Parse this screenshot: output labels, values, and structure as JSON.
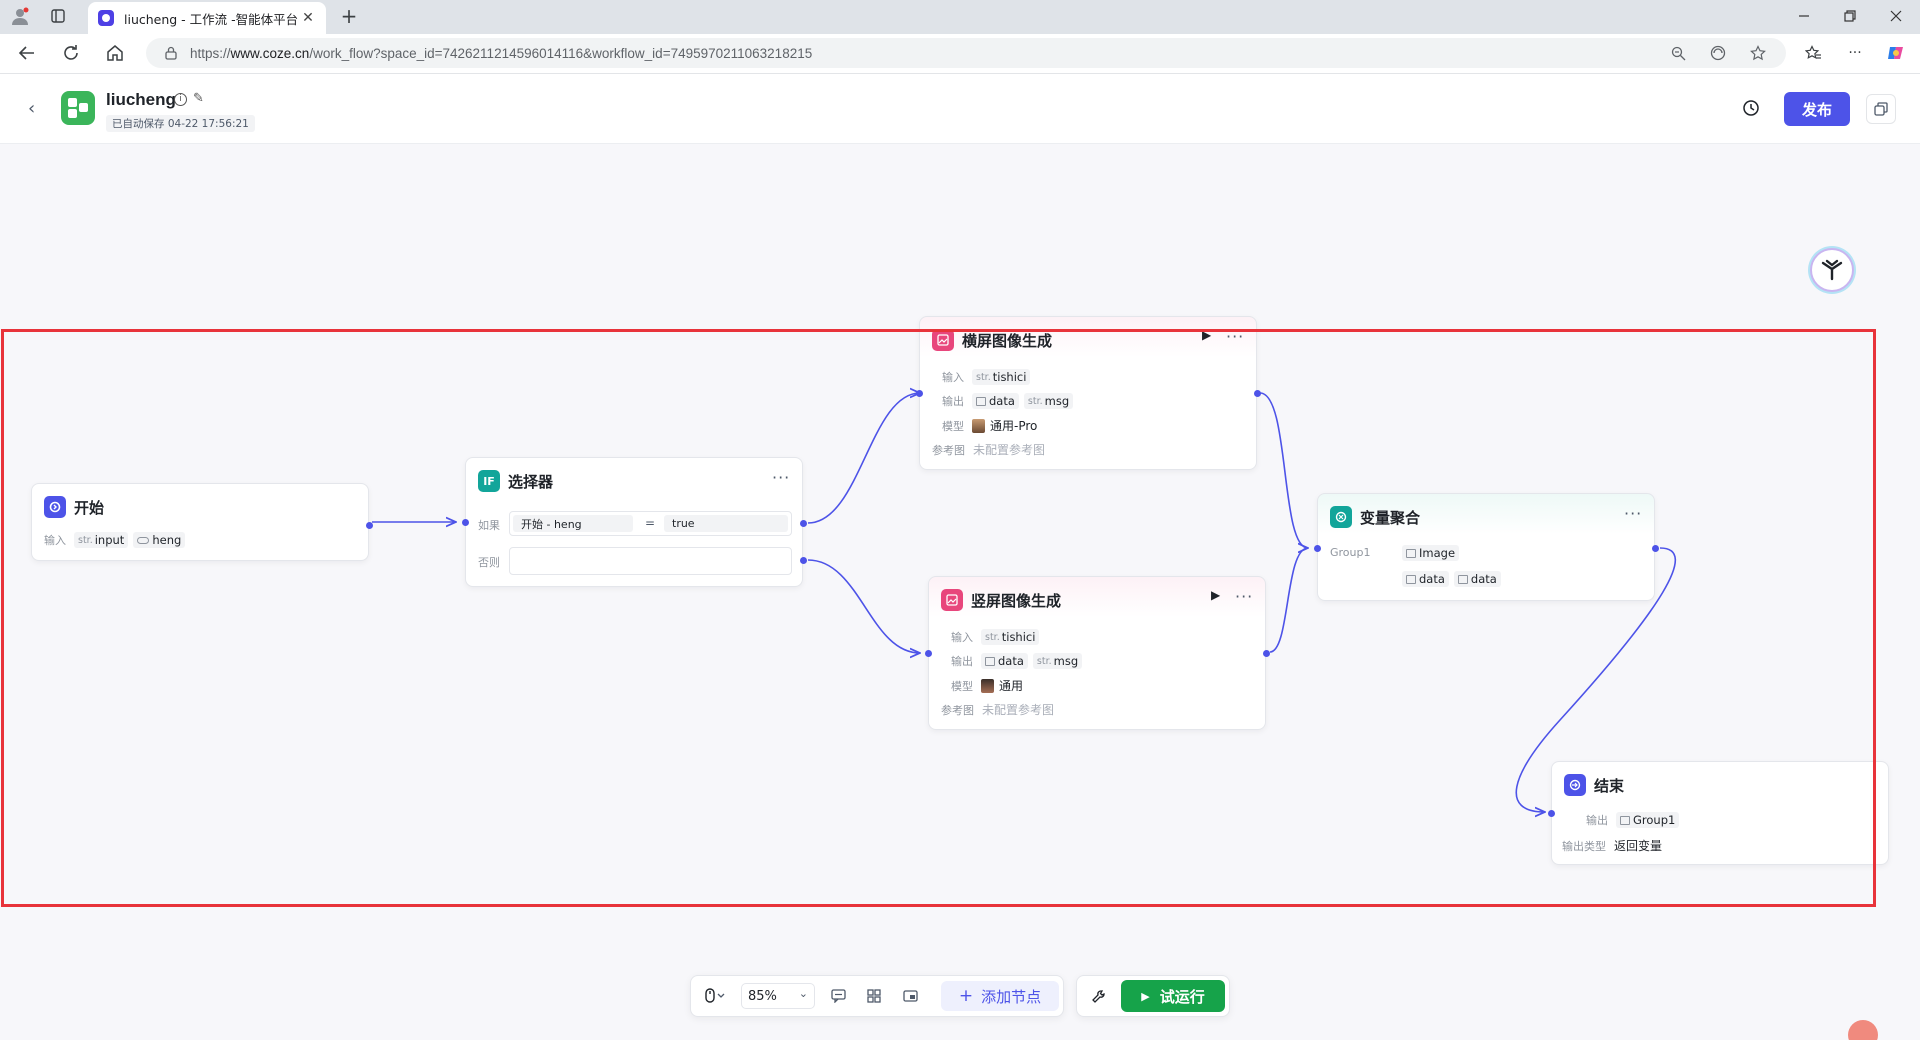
{
  "browser": {
    "tab_title": "liucheng - 工作流 -智能体平台",
    "tab_close": "✕",
    "new_tab": "+",
    "url_prefix": "https://",
    "url_domain": "www.coze.cn",
    "url_path": "/work_flow?space_id=7426211214596014116&workflow_id=7495970211063218215"
  },
  "header": {
    "back": "‹",
    "app_name": "liucheng",
    "info": "i",
    "edit": "✎",
    "autosave": "已自动保存 04-22 17:56:21",
    "publish_label": "发布"
  },
  "nodes": {
    "start": {
      "title": "开始",
      "input_label": "输入",
      "vars": [
        {
          "type": "str.",
          "name": "input"
        },
        {
          "type": "",
          "name": "heng"
        }
      ]
    },
    "selector": {
      "title": "选择器",
      "icon_text": "IF",
      "if_label": "如果",
      "else_label": "否则",
      "cond_left": "开始  -  heng",
      "cond_op": "=",
      "cond_right": "true"
    },
    "landscape": {
      "title": "横屏图像生成",
      "input_label": "输入",
      "output_label": "输出",
      "model_label": "模型",
      "ref_label": "参考图",
      "input_var": "tishici",
      "outputs": [
        "data",
        "msg"
      ],
      "model": "通用-Pro",
      "ref_value": "未配置参考图"
    },
    "portrait": {
      "title": "竖屏图像生成",
      "input_label": "输入",
      "output_label": "输出",
      "model_label": "模型",
      "ref_label": "参考图",
      "input_var": "tishici",
      "outputs": [
        "data",
        "msg"
      ],
      "model": "通用",
      "ref_value": "未配置参考图"
    },
    "aggregate": {
      "title": "变量聚合",
      "group_label": "Group1",
      "items": [
        "Image",
        "data",
        "data"
      ]
    },
    "end": {
      "title": "结束",
      "output_label": "输出",
      "output_type_label": "输出类型",
      "output_var": "Group1",
      "output_type": "返回变量"
    }
  },
  "toolbar": {
    "zoom": "85%",
    "add_node_label": "添加节点",
    "test_run_label": "试运行"
  },
  "colors": {
    "accent": "#4d53e8",
    "edge": "#4d53e8",
    "selection_border": "#e8333a",
    "test_run": "#16a34a",
    "image_node_icon": "#e8467c",
    "selector_icon": "#12a59a",
    "aggregate_icon": "#12a59a"
  }
}
